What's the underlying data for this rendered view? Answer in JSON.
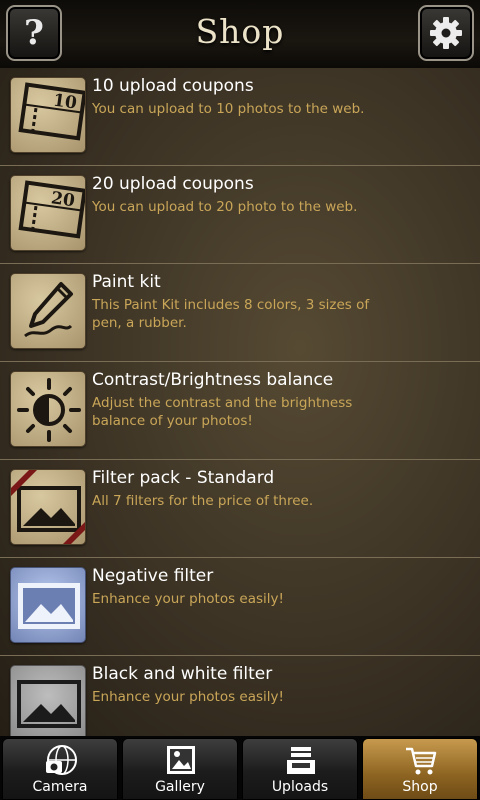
{
  "header": {
    "title": "Shop",
    "help_label": "?"
  },
  "items": [
    {
      "name": "10 upload coupons",
      "desc": "You can upload to 10 photos to the web.",
      "badge": "10"
    },
    {
      "name": "20 upload coupons",
      "desc": "You can upload to 20 photo to the web.",
      "badge": "20"
    },
    {
      "name": "Paint kit",
      "desc": "This Paint Kit includes 8 colors, 3 sizes of pen, a rubber."
    },
    {
      "name": "Contrast/Brightness balance",
      "desc": "Adjust the contrast and the brightness balance of your photos!"
    },
    {
      "name": "Filter pack - Standard",
      "desc": "All 7 filters for the price of three."
    },
    {
      "name": "Negative filter",
      "desc": "Enhance your photos easily!"
    },
    {
      "name": "Black and white filter",
      "desc": "Enhance your photos easily!"
    }
  ],
  "tabs": {
    "camera": "Camera",
    "gallery": "Gallery",
    "uploads": "Uploads",
    "shop": "Shop",
    "active": "Shop"
  },
  "colors": {
    "accent": "#c9a658",
    "active_tab": "#a97b35"
  }
}
